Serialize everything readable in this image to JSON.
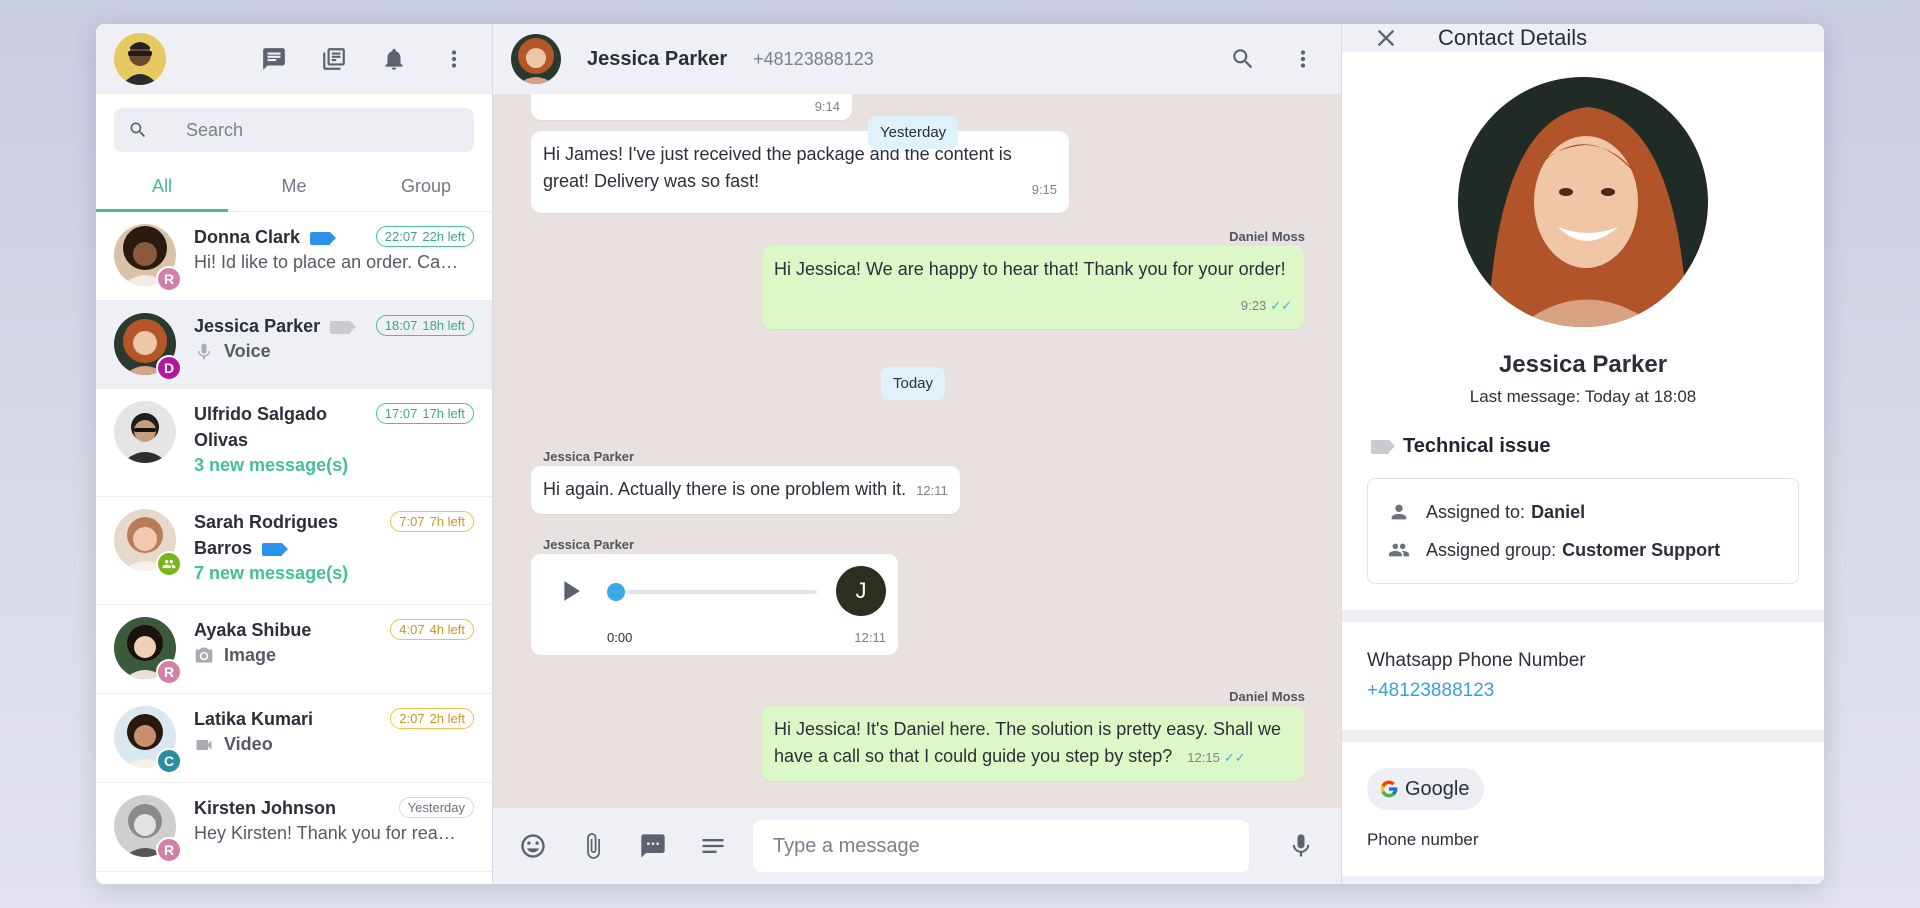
{
  "sidebar": {
    "search_placeholder": "Search",
    "tabs": [
      {
        "label": "All",
        "active": true
      },
      {
        "label": "Me",
        "active": false
      },
      {
        "label": "Group",
        "active": false
      }
    ],
    "chats": [
      {
        "name": "Donna Clark",
        "time": "22:07",
        "time_left": "22h left",
        "preview": "Hi! Id like to place an order. Can you help me?",
        "badge": "R",
        "badge_color": "#d47fa8",
        "tag_color": "#2e93e8",
        "pill": "green"
      },
      {
        "name": "Jessica Parker",
        "time": "18:07",
        "time_left": "18h left",
        "preview": "Voice",
        "badge": "D",
        "badge_color": "#b4179b",
        "tag_color": "#c9cbd0",
        "pill": "green",
        "media": "mic-icon"
      },
      {
        "name": "Ulfrido Salgado Olivas",
        "time": "17:07",
        "time_left": "17h left",
        "preview": "3 new message(s)",
        "pill": "green"
      },
      {
        "name": "Sarah Rodrigues Barros",
        "time": "7:07",
        "time_left": "7h left",
        "preview": "7 new message(s)",
        "badge": "group-icon",
        "badge_color": "#7ab51d",
        "tag_color": "#2e93e8",
        "pill": "yellow"
      },
      {
        "name": "Ayaka Shibue",
        "time": "4:07",
        "time_left": "4h left",
        "preview": "Image",
        "badge": "R",
        "badge_color": "#d47fa8",
        "pill": "yellow",
        "media": "camera-icon"
      },
      {
        "name": "Latika Kumari",
        "time": "2:07",
        "time_left": "2h left",
        "preview": "Video",
        "badge": "C",
        "badge_color": "#2b8ca3",
        "pill": "yellow",
        "media": "video-icon"
      },
      {
        "name": "Kirsten Johnson",
        "time": "Yesterday",
        "time_left": "",
        "preview": "Hey Kirsten! Thank you for reaching out.",
        "badge": "R",
        "badge_color": "#d47fa8",
        "pill": "grey"
      }
    ]
  },
  "conversation": {
    "contact_name": "Jessica Parker",
    "contact_phone": "+48123888123",
    "messages": {
      "m0_time": "9:14",
      "day_yesterday": "Yesterday",
      "m1_text": "Hi James! I've just received the package and the content is great! Delivery was so fast!",
      "m1_time": "9:15",
      "m2_sender": "Daniel Moss",
      "m2_text": "Hi Jessica! We are happy to hear that! Thank you for your order!",
      "m2_time": "9:23",
      "day_today": "Today",
      "m3_sender": "Jessica Parker",
      "m3_text": "Hi again. Actually there is one problem with it.",
      "m3_time": "12:11",
      "m4_sender": "Jessica Parker",
      "m4_duration": "0:00",
      "m4_time": "12:11",
      "m4_avatar_letter": "J",
      "m4_progress": 0,
      "m5_sender": "Daniel Moss",
      "m5_text": "Hi Jessica! It's Daniel here. The solution is pretty easy. Shall we have a call so that I could guide you step by step?",
      "m5_time": "12:15"
    },
    "composer_placeholder": "Type a message"
  },
  "details": {
    "title": "Contact Details",
    "name": "Jessica Parker",
    "last_message": "Last message: Today at 18:08",
    "label": "Technical issue",
    "assigned_to_label": "Assigned to:",
    "assigned_to": "Daniel",
    "assigned_group_label": "Assigned group:",
    "assigned_group": "Customer Support",
    "phone_label": "Whatsapp Phone Number",
    "phone": "+48123888123",
    "google_label": "Google",
    "google_sub": "Phone number"
  },
  "colors": {
    "accent": "#3fbf93",
    "outgoing_bubble": "#dcf8c6",
    "chat_background": "#e8e1df",
    "link": "#3aa0dc"
  }
}
